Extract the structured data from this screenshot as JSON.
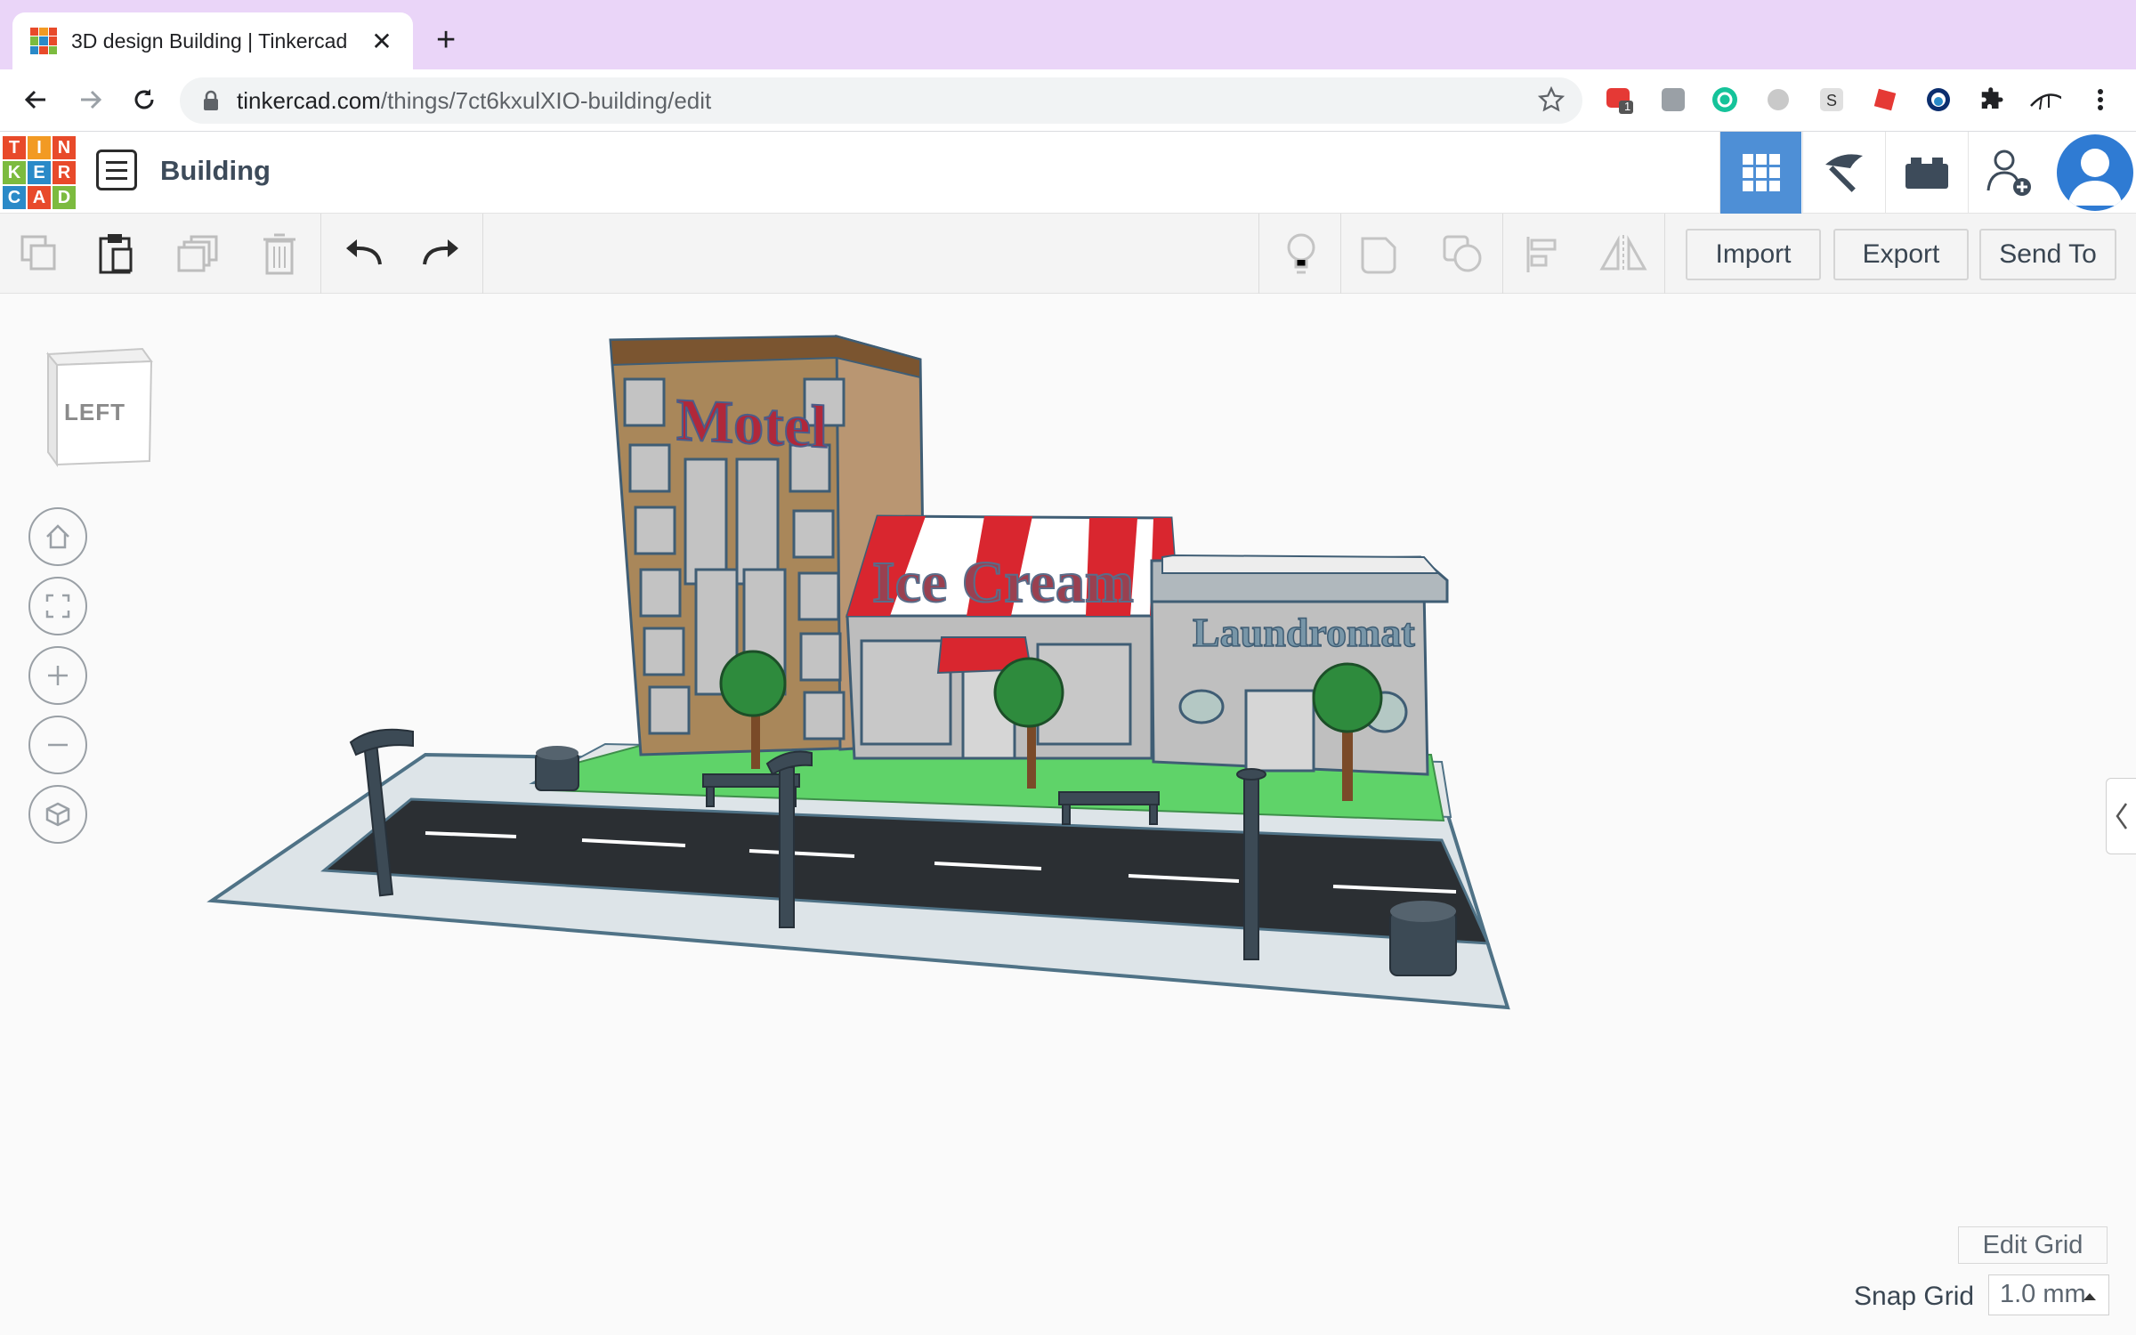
{
  "browser": {
    "tab_title": "3D design Building | Tinkercad",
    "new_tab_symbol": "+",
    "close_symbol": "✕",
    "url_host": "tinkercad.com",
    "url_path": "/things/7ct6kxulXIO-building/edit",
    "extension_badge": "1"
  },
  "app": {
    "logo_letters": [
      "T",
      "I",
      "N",
      "K",
      "E",
      "R",
      "C",
      "A",
      "D"
    ],
    "logo_colors": [
      "#e84a2a",
      "#f29a23",
      "#e84a2a",
      "#7cbb3f",
      "#2a8ac8",
      "#e84a2a",
      "#2a8ac8",
      "#e84a2a",
      "#7cbb3f"
    ],
    "design_title": "Building"
  },
  "toolbar": {
    "import_label": "Import",
    "export_label": "Export",
    "send_to_label": "Send To"
  },
  "viewcube": {
    "face_label": "LEFT"
  },
  "scene_labels": {
    "motel": "Motel",
    "ice_cream": "Ice Cream",
    "laundromat": "Laundromat"
  },
  "grid": {
    "edit_grid_label": "Edit Grid",
    "snap_grid_label": "Snap Grid",
    "snap_value": "1.0 mm"
  },
  "colors": {
    "accent": "#4e8fd6",
    "tab_strip": "#ead5f8"
  }
}
